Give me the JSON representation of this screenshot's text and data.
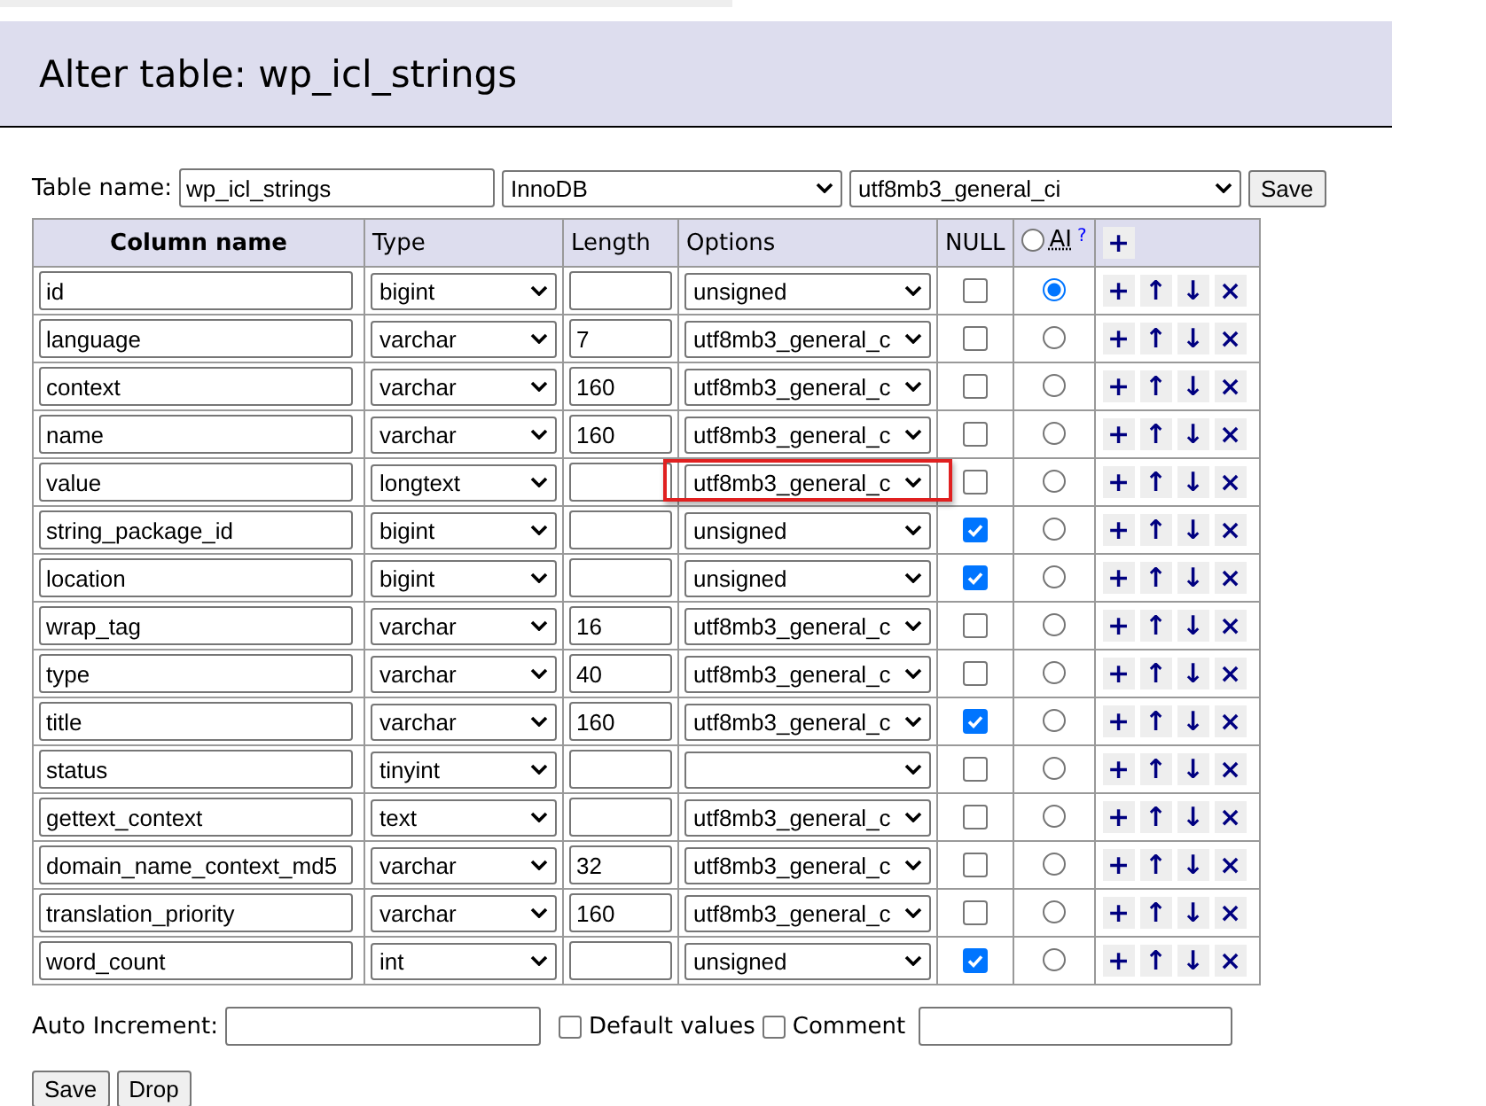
{
  "title": "Alter table: wp_icl_strings",
  "table_name": {
    "label": "Table name:",
    "value": "wp_icl_strings",
    "engine": "InnoDB",
    "collation": "utf8mb3_general_ci",
    "save": "Save"
  },
  "columns": [
    "Column name",
    "Type",
    "Length",
    "Options",
    "NULL"
  ],
  "ai_header": {
    "label": "AI",
    "help": "?",
    "selected": false,
    "add": "+"
  },
  "actions": [
    "+",
    "↑",
    "↓",
    "×"
  ],
  "rows": [
    {
      "name": "id",
      "type": "bigint",
      "length": "",
      "options": "unsigned",
      "null": false,
      "ai": true,
      "highlighted": false
    },
    {
      "name": "language",
      "type": "varchar",
      "length": "7",
      "options": "utf8mb3_general_c",
      "null": false,
      "ai": false,
      "highlighted": false
    },
    {
      "name": "context",
      "type": "varchar",
      "length": "160",
      "options": "utf8mb3_general_c",
      "null": false,
      "ai": false,
      "highlighted": false
    },
    {
      "name": "name",
      "type": "varchar",
      "length": "160",
      "options": "utf8mb3_general_c",
      "null": false,
      "ai": false,
      "highlighted": false
    },
    {
      "name": "value",
      "type": "longtext",
      "length": "",
      "options": "utf8mb3_general_c",
      "null": false,
      "ai": false,
      "highlighted": true
    },
    {
      "name": "string_package_id",
      "type": "bigint",
      "length": "",
      "options": "unsigned",
      "null": true,
      "ai": false,
      "highlighted": false
    },
    {
      "name": "location",
      "type": "bigint",
      "length": "",
      "options": "unsigned",
      "null": true,
      "ai": false,
      "highlighted": false
    },
    {
      "name": "wrap_tag",
      "type": "varchar",
      "length": "16",
      "options": "utf8mb3_general_c",
      "null": false,
      "ai": false,
      "highlighted": false
    },
    {
      "name": "type",
      "type": "varchar",
      "length": "40",
      "options": "utf8mb3_general_c",
      "null": false,
      "ai": false,
      "highlighted": false
    },
    {
      "name": "title",
      "type": "varchar",
      "length": "160",
      "options": "utf8mb3_general_c",
      "null": true,
      "ai": false,
      "highlighted": false
    },
    {
      "name": "status",
      "type": "tinyint",
      "length": "",
      "options": "",
      "null": false,
      "ai": false,
      "highlighted": false
    },
    {
      "name": "gettext_context",
      "type": "text",
      "length": "",
      "options": "utf8mb3_general_c",
      "null": false,
      "ai": false,
      "highlighted": false
    },
    {
      "name": "domain_name_context_md5",
      "type": "varchar",
      "length": "32",
      "options": "utf8mb3_general_c",
      "null": false,
      "ai": false,
      "highlighted": false
    },
    {
      "name": "translation_priority",
      "type": "varchar",
      "length": "160",
      "options": "utf8mb3_general_c",
      "null": false,
      "ai": false,
      "highlighted": false
    },
    {
      "name": "word_count",
      "type": "int",
      "length": "",
      "options": "unsigned",
      "null": true,
      "ai": false,
      "highlighted": false
    }
  ],
  "auto_increment": {
    "label": "Auto Increment:"
  },
  "default_values": {
    "label": "Default values",
    "checked": false
  },
  "comment": {
    "label": "Comment",
    "checked": false
  },
  "buttons": [
    "Save",
    "Drop"
  ]
}
